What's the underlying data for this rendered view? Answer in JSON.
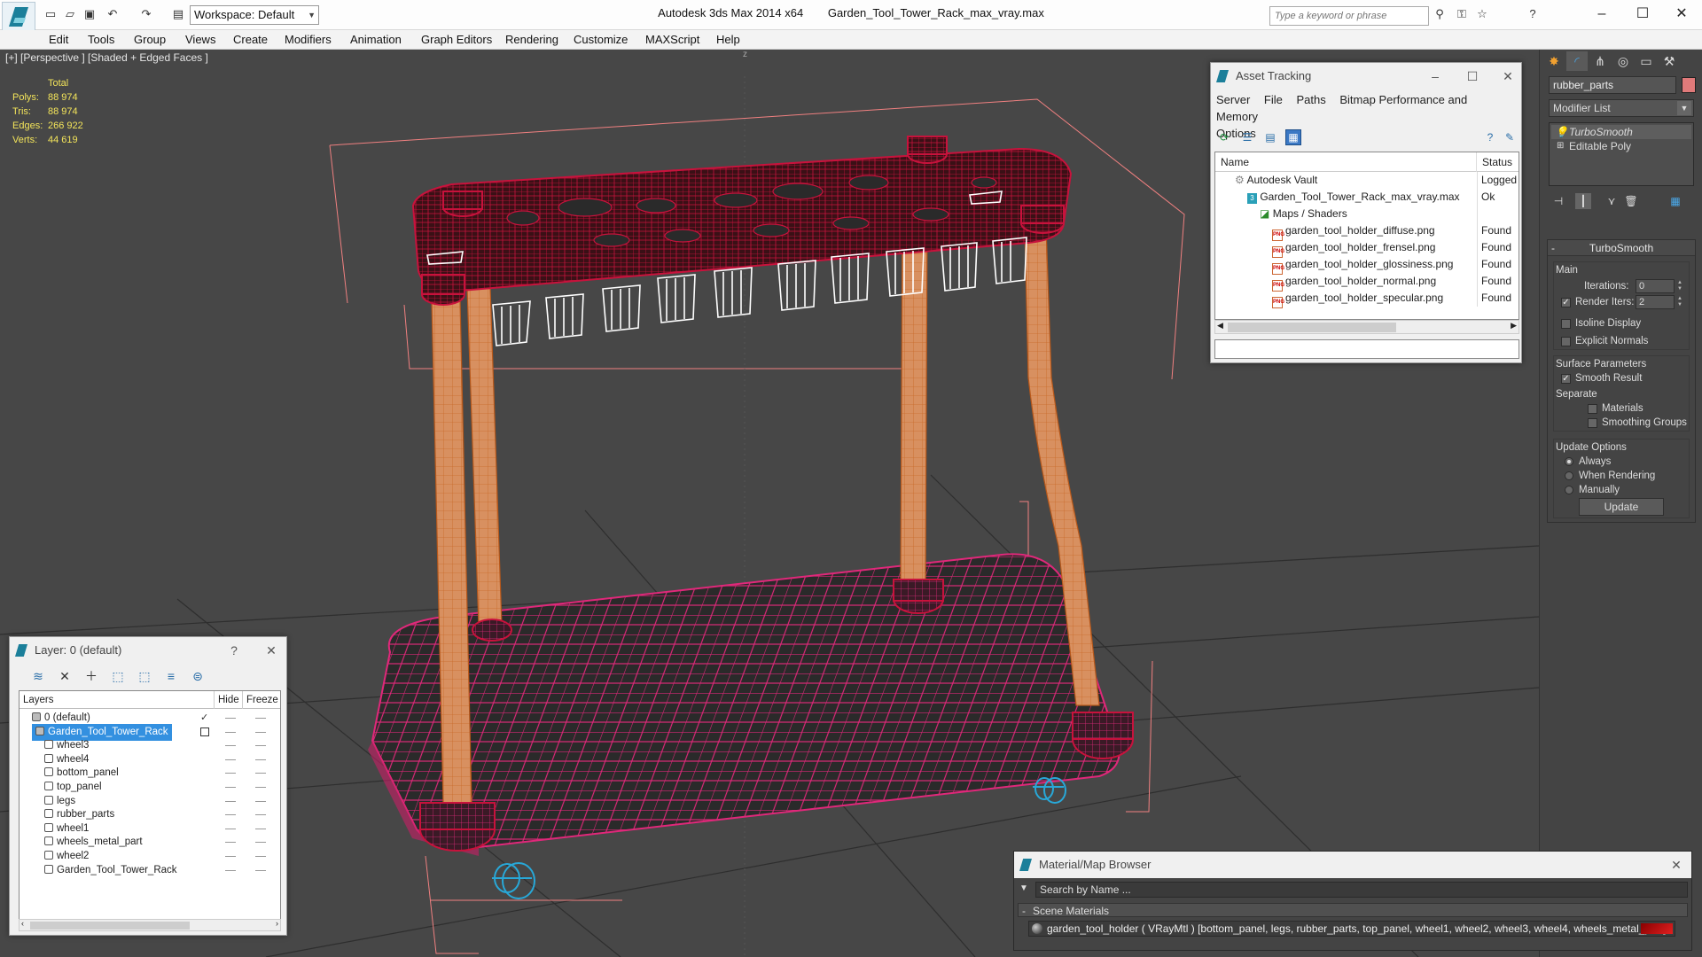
{
  "titlebar": {
    "app_name": "Autodesk 3ds Max  2014 x64",
    "file_name": "Garden_Tool_Tower_Rack_max_vray.max",
    "workspace_label": "Workspace: Default",
    "search_placeholder": "Type a keyword or phrase"
  },
  "menubar": {
    "items": [
      "Edit",
      "Tools",
      "Group",
      "Views",
      "Create",
      "Modifiers",
      "Animation",
      "Graph Editors",
      "Rendering",
      "Customize",
      "MAXScript",
      "Help"
    ]
  },
  "viewport": {
    "label": "[+] [Perspective ] [Shaded + Edged Faces ]",
    "stats": {
      "header": "Total",
      "polys_label": "Polys:",
      "polys": "88 974",
      "tris_label": "Tris:",
      "tris": "88 974",
      "edges_label": "Edges:",
      "edges": "266 922",
      "verts_label": "Verts:",
      "verts": "44 619"
    },
    "axis_label": "z"
  },
  "asset_tracking": {
    "title": "Asset Tracking",
    "menu": [
      "Server",
      "File",
      "Paths",
      "Bitmap Performance and Memory",
      "Options"
    ],
    "columns": [
      "Name",
      "Status"
    ],
    "rows": [
      {
        "name": "Autodesk Vault",
        "status": "Logged O"
      },
      {
        "name": "Garden_Tool_Tower_Rack_max_vray.max",
        "status": "Ok"
      },
      {
        "name": "Maps / Shaders",
        "status": ""
      },
      {
        "name": "garden_tool_holder_diffuse.png",
        "status": "Found"
      },
      {
        "name": "garden_tool_holder_frensel.png",
        "status": "Found"
      },
      {
        "name": "garden_tool_holder_glossiness.png",
        "status": "Found"
      },
      {
        "name": "garden_tool_holder_normal.png",
        "status": "Found"
      },
      {
        "name": "garden_tool_holder_specular.png",
        "status": "Found"
      }
    ]
  },
  "command_panel": {
    "object_name": "rubber_parts",
    "object_color": "#e07a7a",
    "modifier_list_label": "Modifier List",
    "stack": [
      "TurboSmooth",
      "Editable Poly"
    ],
    "turbosmooth": {
      "title": "TurboSmooth",
      "main_label": "Main",
      "iterations_label": "Iterations:",
      "iterations": "0",
      "render_iters_label": "Render Iters:",
      "render_iters": "2",
      "isoline_label": "Isoline Display",
      "explicit_normals_label": "Explicit Normals",
      "surface_label": "Surface Parameters",
      "smooth_result_label": "Smooth Result",
      "separate_label": "Separate",
      "materials_label": "Materials",
      "smoothing_groups_label": "Smoothing Groups",
      "update_options_label": "Update Options",
      "always_label": "Always",
      "when_rendering_label": "When Rendering",
      "manually_label": "Manually",
      "update_button": "Update"
    }
  },
  "layer_panel": {
    "title": "Layer: 0 (default)",
    "help": "?",
    "columns": [
      "Layers",
      "Hide",
      "Freeze"
    ],
    "rows": [
      {
        "name": "0 (default)",
        "indent": 0,
        "type": "layer",
        "selected": false
      },
      {
        "name": "Garden_Tool_Tower_Rack",
        "indent": 0,
        "type": "layer",
        "selected": true
      },
      {
        "name": "wheel3",
        "indent": 1,
        "type": "object",
        "selected": false
      },
      {
        "name": "wheel4",
        "indent": 1,
        "type": "object",
        "selected": false
      },
      {
        "name": "bottom_panel",
        "indent": 1,
        "type": "object",
        "selected": false
      },
      {
        "name": "top_panel",
        "indent": 1,
        "type": "object",
        "selected": false
      },
      {
        "name": "legs",
        "indent": 1,
        "type": "object",
        "selected": false
      },
      {
        "name": "rubber_parts",
        "indent": 1,
        "type": "object",
        "selected": false
      },
      {
        "name": "wheel1",
        "indent": 1,
        "type": "object",
        "selected": false
      },
      {
        "name": "wheels_metal_part",
        "indent": 1,
        "type": "object",
        "selected": false
      },
      {
        "name": "wheel2",
        "indent": 1,
        "type": "object",
        "selected": false
      },
      {
        "name": "Garden_Tool_Tower_Rack",
        "indent": 1,
        "type": "object",
        "selected": false
      }
    ]
  },
  "material_browser": {
    "title": "Material/Map Browser",
    "search_placeholder": "Search by Name ...",
    "section": "Scene Materials",
    "material_entry": "garden_tool_holder  ( VRayMtl )  [bottom_panel, legs, rubber_parts, top_panel, wheel1, wheel2, wheel3, wheel4, wheels_metal_part]"
  },
  "colors": {
    "viewport_bg": "#474747",
    "wire_red": "#c8123c",
    "wire_pink": "#e0287a",
    "wire_orange": "#e08a40",
    "wire_white": "#ffffff",
    "wire_cyan": "#28a8d8",
    "stats_yellow": "#f3e45a"
  }
}
